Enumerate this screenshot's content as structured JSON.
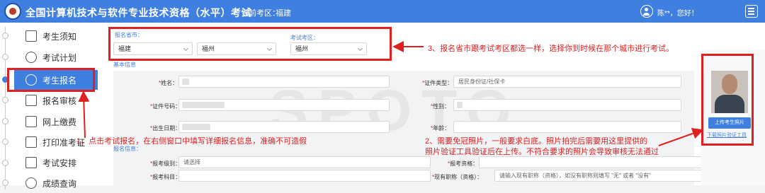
{
  "header": {
    "title": "全国计算机技术与软件专业技术资格（水平）考试",
    "region_label": "当前考区：",
    "region_value": "福建",
    "greeting": "陈**，您好！"
  },
  "sidebar": {
    "items": [
      {
        "label": "考生须知",
        "icon": "notice-icon"
      },
      {
        "label": "考试计划",
        "icon": "clock-icon"
      },
      {
        "label": "考生报名",
        "icon": "clock-icon"
      },
      {
        "label": "报名审核",
        "icon": "review-icon"
      },
      {
        "label": "网上缴费",
        "icon": "monitor-icon"
      },
      {
        "label": "打印准考证",
        "icon": "printer-icon"
      },
      {
        "label": "考试安排",
        "icon": "document-icon"
      },
      {
        "label": "成绩查询",
        "icon": "search-icon"
      }
    ]
  },
  "location": {
    "province_city_label": "报名省市：",
    "province": "福建",
    "city": "福州",
    "exam_region_label": "考试考区：",
    "exam_region": "福州"
  },
  "form": {
    "basic_info_label": "基本信息",
    "name_label": "姓名：",
    "id_type_label": "证件类型：",
    "id_type_value": "居民身份证/社保卡",
    "id_number_label": "证件号码：",
    "gender_label": "性别：",
    "birth_label": "出生日期：",
    "age_label": "年龄：",
    "apply_info_label": "报名信息：",
    "level_label": "报考级别：",
    "level_placeholder": "请选择",
    "qualification_label": "报考资格：",
    "subject_label": "报考科目：",
    "title_label": "现有职称（资格）：",
    "title_placeholder": "请输入现有职称（资格），如没有职称则填写 \"无\" 或者 \"没有\""
  },
  "photo": {
    "upload_button": "上传考生照片",
    "verify_link": "下载照片验证工具"
  },
  "watermark": "SPOTO",
  "annotations": {
    "note1": "1、点击考试报名，在右侧窗口中填写详细报名信息，准确不可造假",
    "note2_line1": "2、需要免冠照片，一般要求白底。照片拍完后需要用这里提供的",
    "note2_line2": "照片验证工具验证后在上传。不符合要求的照片会导致审核无法通过",
    "note3": "3、报名省市跟考试考区都选一样，选择你到时候在那个城市进行考试。"
  },
  "colors": {
    "primary": "#3f7fe0",
    "annotation_red": "#e02020"
  }
}
